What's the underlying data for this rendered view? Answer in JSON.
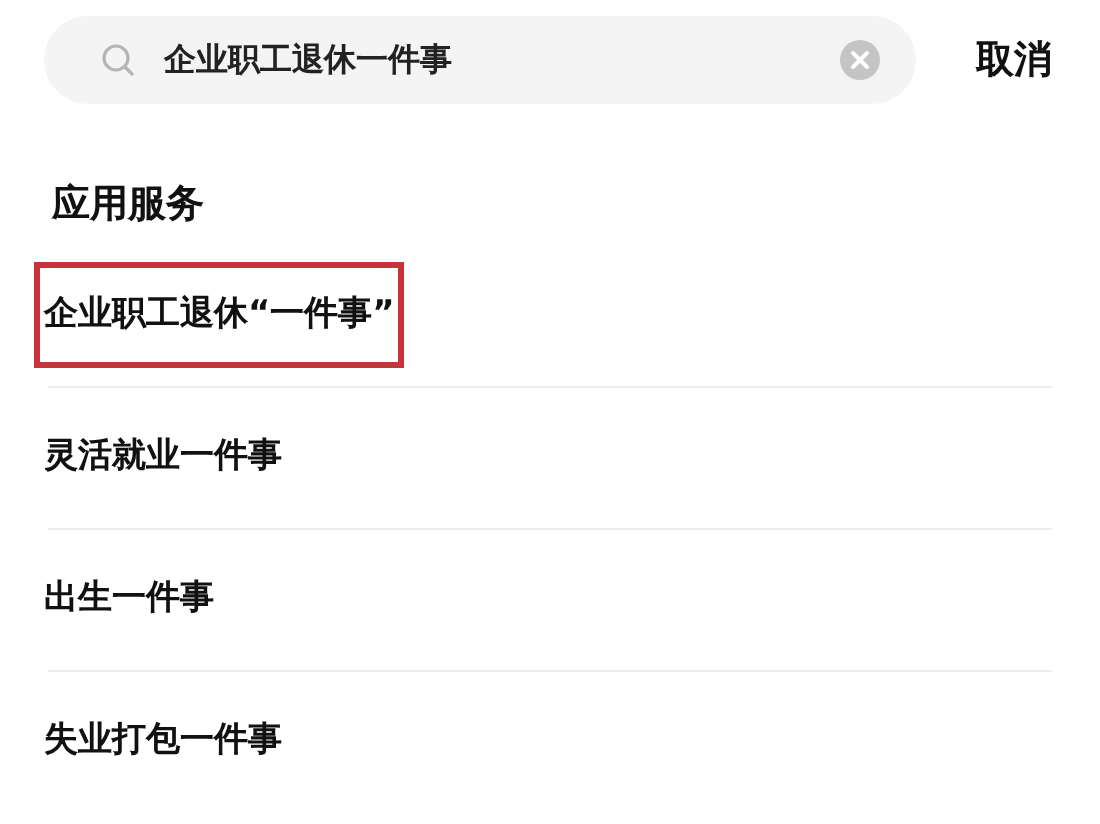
{
  "search": {
    "value": "企业职工退休一件事"
  },
  "cancel_label": "取消",
  "section_title": "应用服务",
  "items": [
    {
      "label": "企业职工退休“一件事”",
      "highlighted": true
    },
    {
      "label": "灵活就业一件事",
      "highlighted": false
    },
    {
      "label": "出生一件事",
      "highlighted": false
    },
    {
      "label": "失业打包一件事",
      "highlighted": false
    }
  ]
}
